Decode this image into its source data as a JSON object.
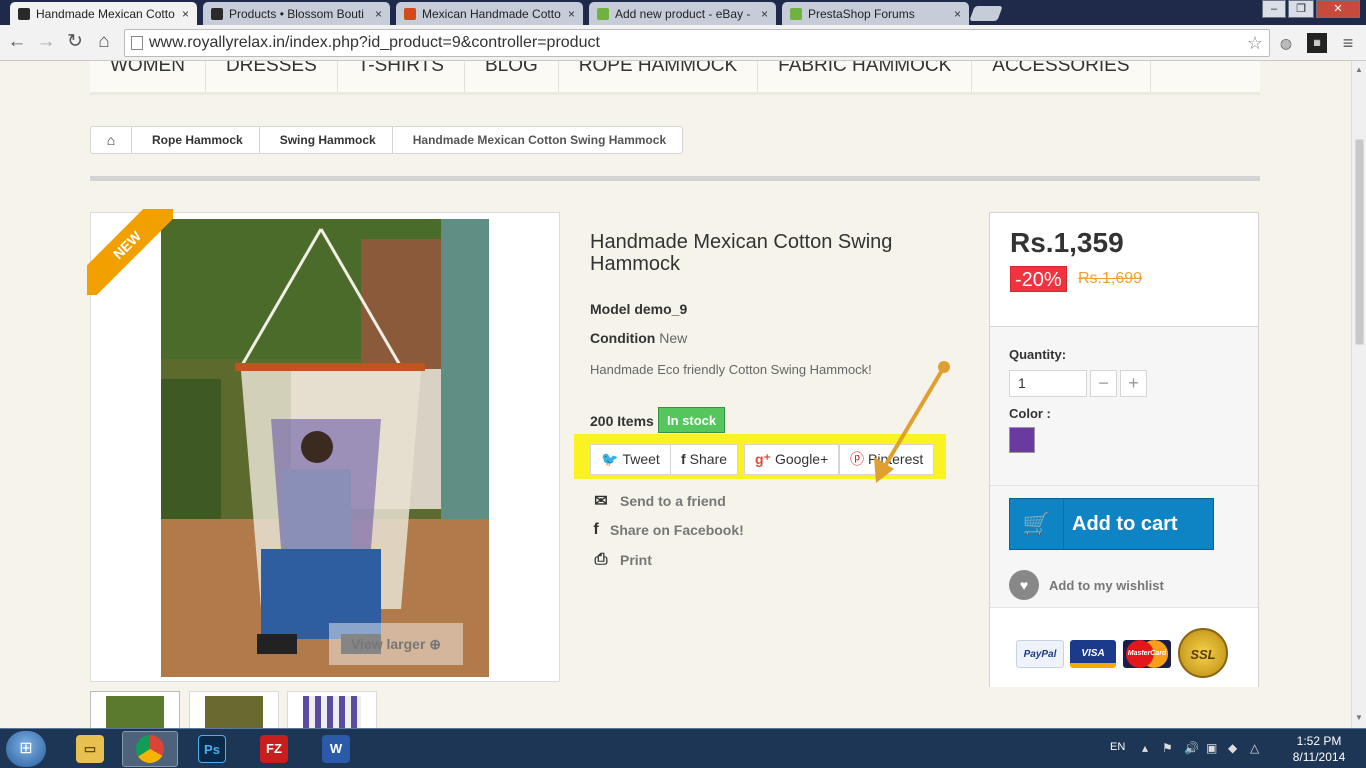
{
  "browser": {
    "tabs": [
      {
        "label": "Handmade Mexican Cotto",
        "active": true,
        "color": "#2a2a2a"
      },
      {
        "label": "Products • Blossom Bouti",
        "active": false,
        "color": "#2a2a2a"
      },
      {
        "label": "Mexican Handmade Cotto",
        "active": false,
        "color": "#d14b1f"
      },
      {
        "label": "Add new product - eBay -",
        "active": false,
        "color": "#6fb23f"
      },
      {
        "label": "PrestaShop Forums",
        "active": false,
        "color": "#6fb23f"
      }
    ],
    "tab_close": "×",
    "address": "www.royallyrelax.in/index.php?id_product=9&controller=product",
    "window_buttons": [
      "–",
      "❐",
      "✕"
    ]
  },
  "menu": {
    "items": [
      "WOMEN",
      "DRESSES",
      "T-SHIRTS",
      "BLOG",
      "ROPE HAMMOCK",
      "FABRIC HAMMOCK",
      "ACCESSORIES"
    ]
  },
  "breadcrumb": {
    "home_icon": "home-icon",
    "items": [
      "Rope Hammock",
      "Swing Hammock",
      "Handmade Mexican Cotton Swing Hammock"
    ]
  },
  "product": {
    "new_label": "NEW",
    "view_larger": "View larger",
    "title": "Handmade Mexican Cotton Swing Hammock",
    "model_label": "Model",
    "model_value": "demo_9",
    "condition_label": "Condition",
    "condition_value": "New",
    "description": "Handmade Eco friendly Cotton Swing Hammock!",
    "items_count": "200 Items",
    "stock_status": "In stock",
    "share_buttons": [
      "Tweet",
      "Share",
      "Google+",
      "Pinterest"
    ],
    "links": [
      "Send to a friend",
      "Share on Facebook!",
      "Print"
    ]
  },
  "buy": {
    "price": "Rs.1,359",
    "discount": "-20%",
    "old_price": "Rs.1,699",
    "quantity_label": "Quantity:",
    "quantity_value": "1",
    "minus": "−",
    "plus": "+",
    "color_label": "Color :",
    "color_swatch": "#6a3aa0",
    "add_to_cart": "Add to cart",
    "wishlist": "Add to my wishlist",
    "payments": [
      "PayPal",
      "VISA",
      "MasterCard",
      "SSL"
    ]
  },
  "taskbar": {
    "apps": [
      "Explorer",
      "Chrome",
      "Ps",
      "FZ",
      "W"
    ],
    "language": "EN",
    "time": "1:52 PM",
    "date": "8/11/2014"
  },
  "colors": {
    "accent_blue": "#0f84c4",
    "stock_green": "#55c65e",
    "discount_red": "#f13340",
    "highlight_yellow": "#fbf224",
    "new_band_orange": "#f29f00",
    "annotation_arrow": "#e0a030"
  }
}
